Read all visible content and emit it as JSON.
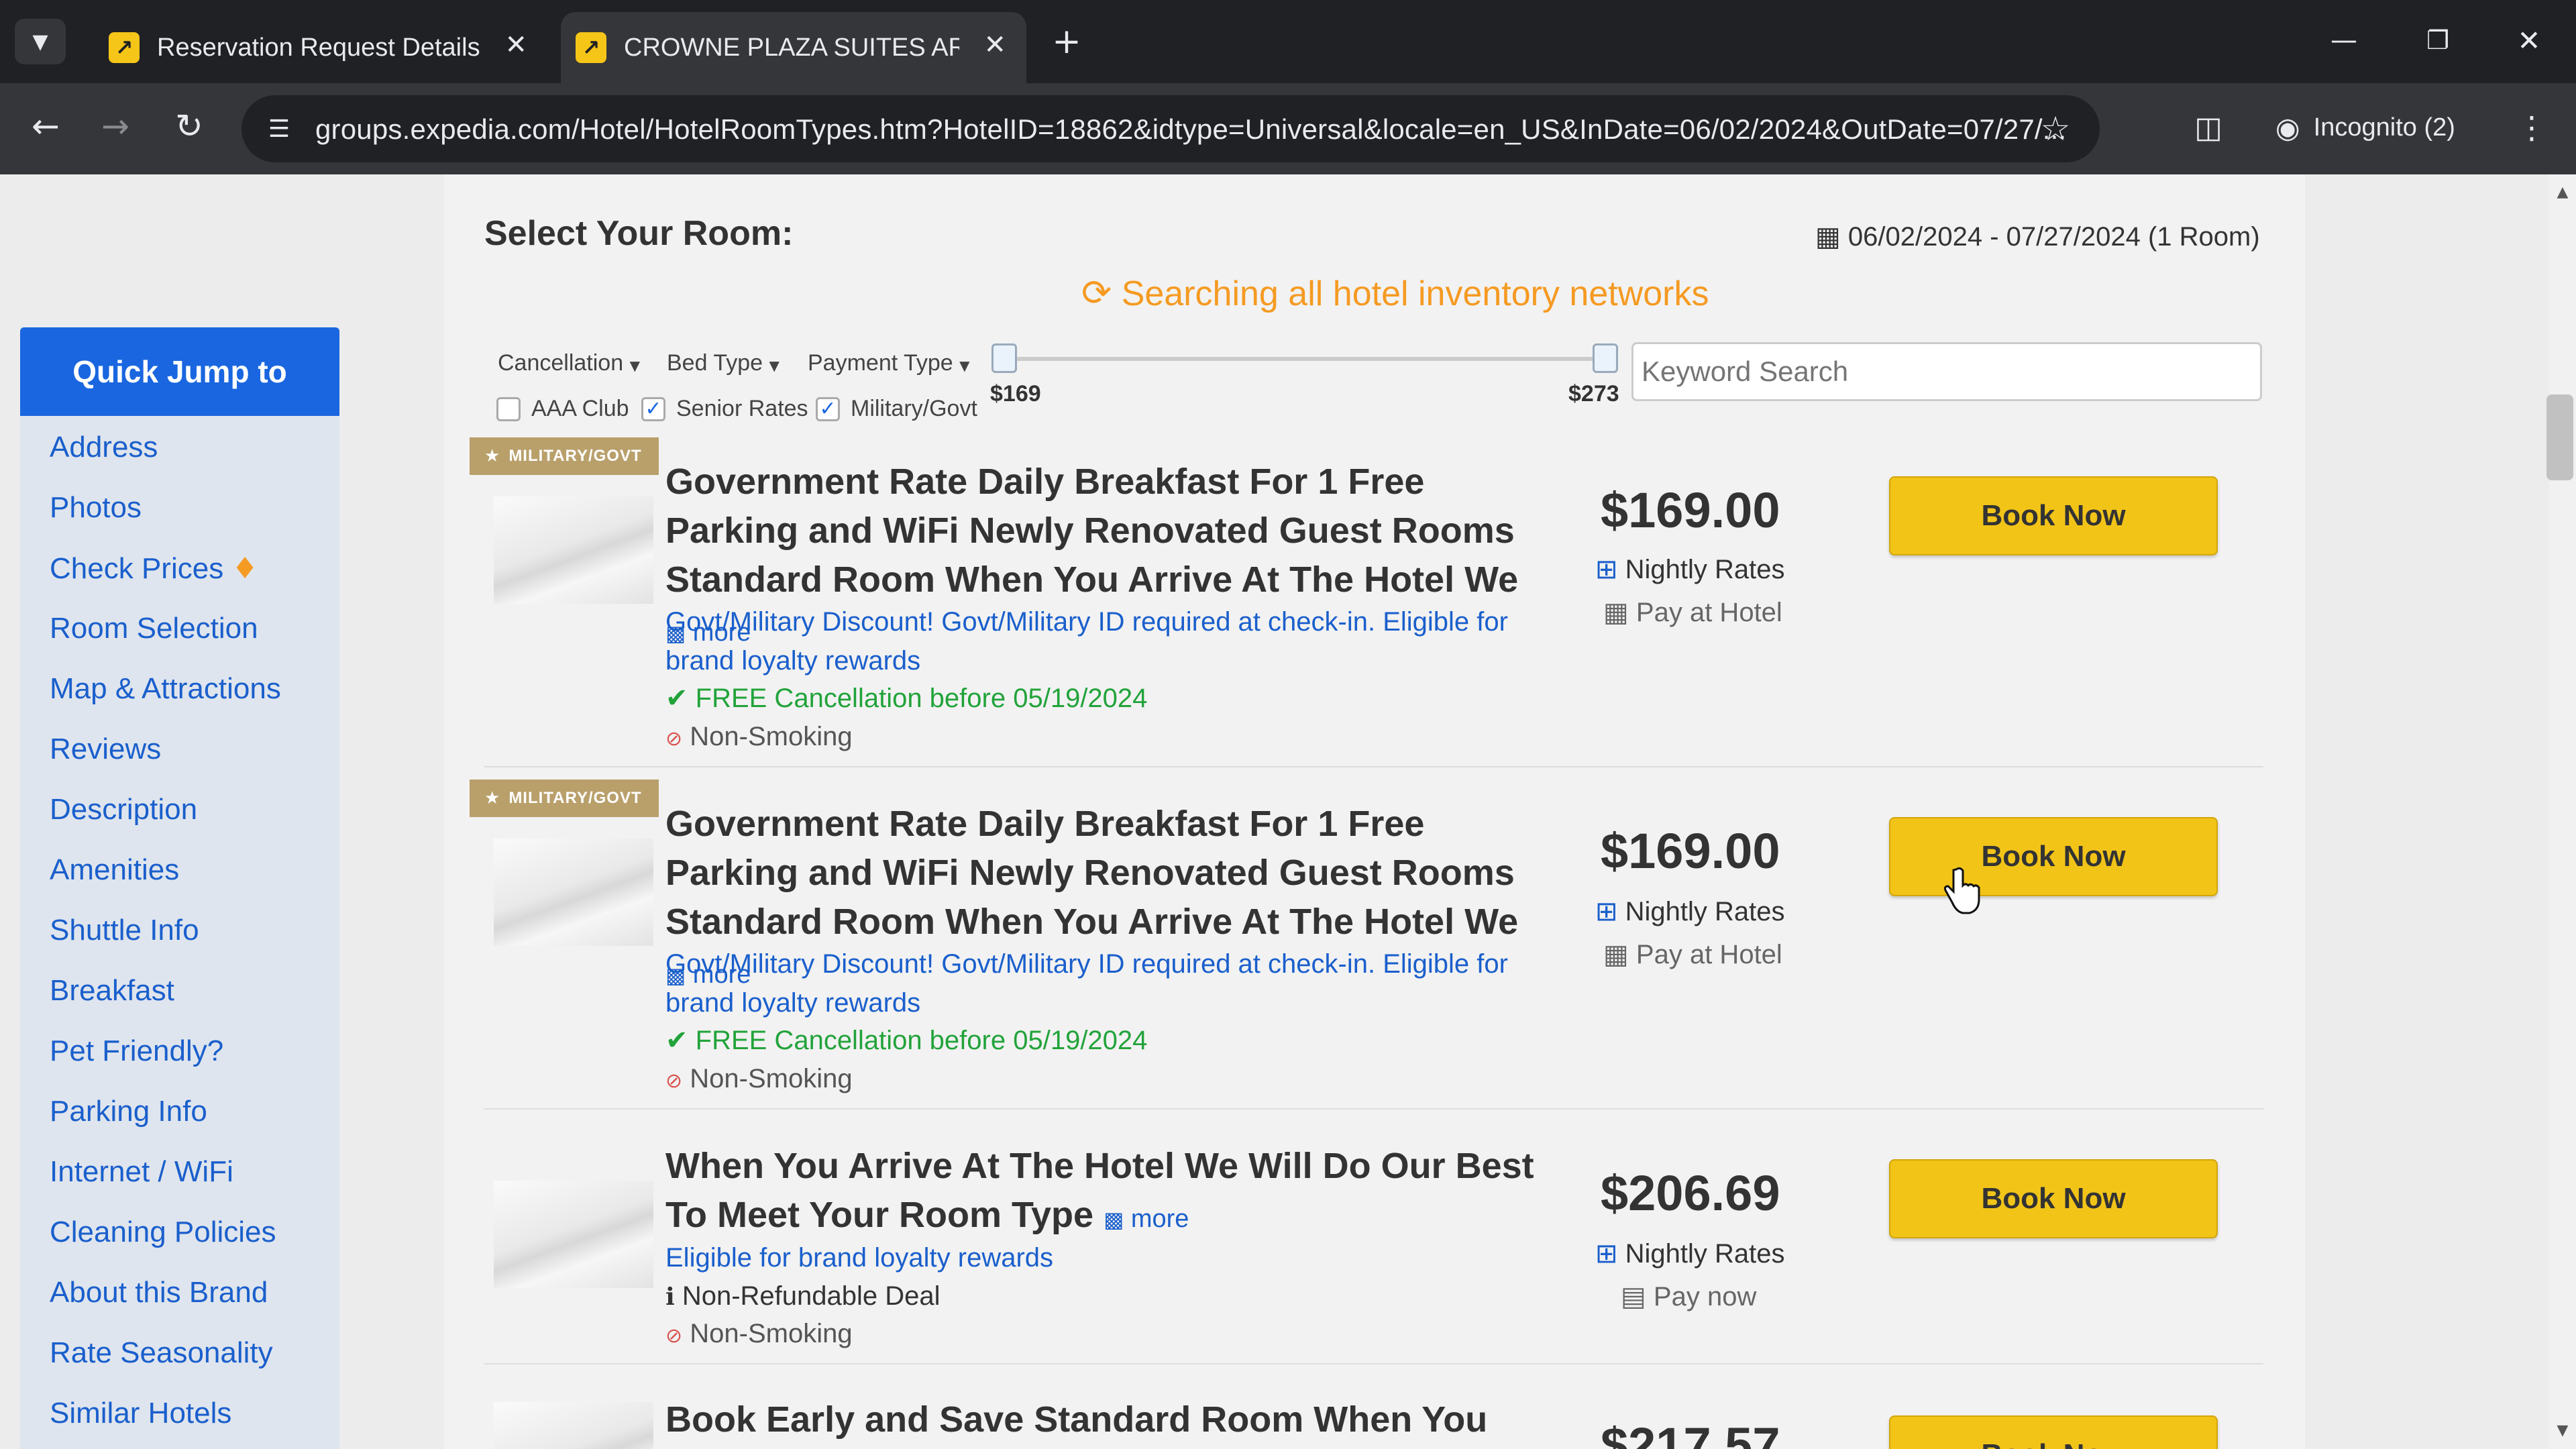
{
  "browser": {
    "tabs": [
      {
        "title": "Reservation Request Details"
      },
      {
        "title": "CROWNE PLAZA SUITES ARLIN"
      }
    ],
    "url": "groups.expedia.com/Hotel/HotelRoomTypes.htm?HotelID=18862&idtype=Universal&locale=en_US&InDate=06/02/2024&OutDate=07/27/...",
    "incognito": "Incognito (2)"
  },
  "sidebar": {
    "header": "Quick Jump to",
    "items": [
      "Address",
      "Photos",
      "Check Prices",
      "Room Selection",
      "Map & Attractions",
      "Reviews",
      "Description",
      "Amenities",
      "Shuttle Info",
      "Breakfast",
      "Pet Friendly?",
      "Parking Info",
      "Internet / WiFi",
      "Cleaning Policies",
      "About this Brand",
      "Rate Seasonality",
      "Similar Hotels"
    ]
  },
  "main": {
    "title": "Select Your Room:",
    "date_range": "06/02/2024 - 07/27/2024 (1 Room)",
    "searching": "Searching all hotel inventory networks",
    "filters": {
      "cancellation": "Cancellation",
      "bed_type": "Bed Type",
      "payment_type": "Payment Type",
      "price_min": "$169",
      "price_max": "$273",
      "keyword_placeholder": "Keyword Search",
      "aaa": "AAA Club",
      "senior": "Senior Rates",
      "military": "Military/Govt"
    }
  },
  "rooms": [
    {
      "ribbon": "MILITARY/GOVT",
      "title": "Government Rate Daily Breakfast For 1 Free Parking and WiFi Newly Renovated Guest Rooms Standard Room When You Arrive At The Hotel We",
      "more": "more",
      "desc": "Govt/Military Discount! Govt/Military ID required at check-in. Eligible for brand loyalty rewards",
      "cancel": "FREE Cancellation before 05/19/2024",
      "smoking": "Non-Smoking",
      "price": "$169.00",
      "nightly": "Nightly Rates",
      "pay": "Pay at Hotel",
      "book": "Book Now"
    },
    {
      "ribbon": "MILITARY/GOVT",
      "title": "Government Rate Daily Breakfast For 1 Free Parking and WiFi Newly Renovated Guest Rooms Standard Room When You Arrive At The Hotel We",
      "more": "more",
      "desc": "Govt/Military Discount! Govt/Military ID required at check-in. Eligible for brand loyalty rewards",
      "cancel": "FREE Cancellation before 05/19/2024",
      "smoking": "Non-Smoking",
      "price": "$169.00",
      "nightly": "Nightly Rates",
      "pay": "Pay at Hotel",
      "book": "Book Now"
    },
    {
      "title": "When You Arrive At The Hotel We Will Do Our Best To Meet Your Room Type",
      "more": "more",
      "desc": "Eligible for brand loyalty rewards",
      "refund": "Non-Refundable Deal",
      "smoking": "Non-Smoking",
      "price": "$206.69",
      "nightly": "Nightly Rates",
      "pay": "Pay now",
      "book": "Book Now"
    },
    {
      "title": "Book Early and Save Standard Room When You",
      "price": "$217.57",
      "book": "Book Now"
    }
  ]
}
